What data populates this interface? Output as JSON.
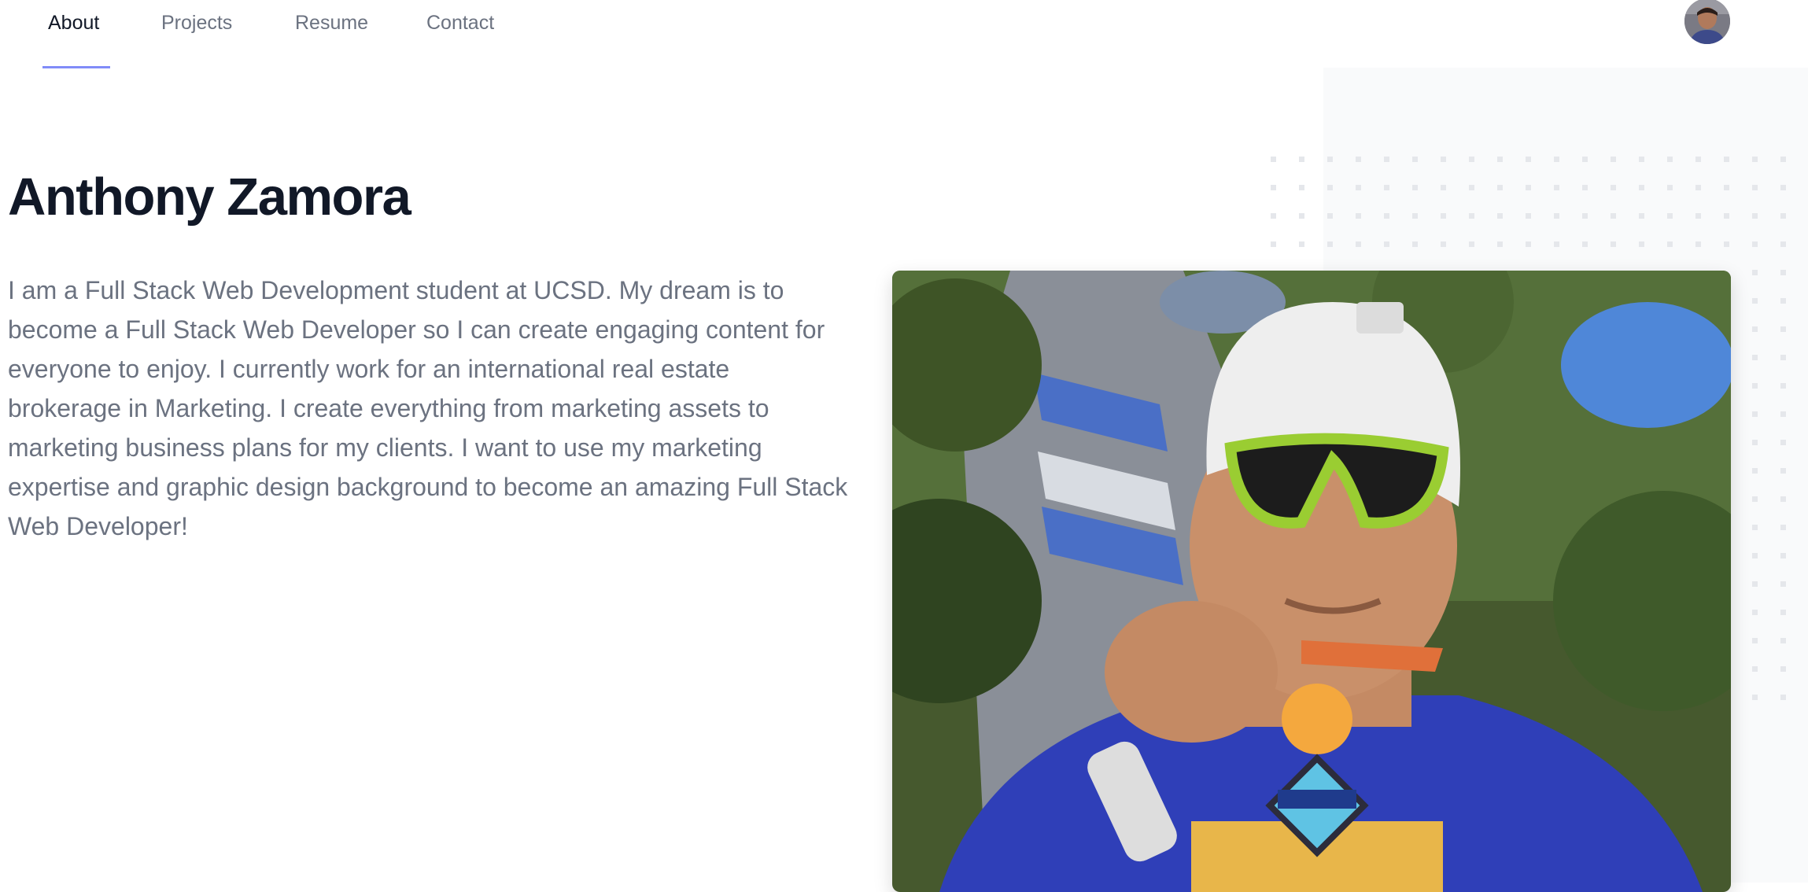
{
  "nav": {
    "tabs": [
      {
        "label": "About",
        "active": true
      },
      {
        "label": "Projects",
        "active": false
      },
      {
        "label": "Resume",
        "active": false
      },
      {
        "label": "Contact",
        "active": false
      }
    ],
    "active_underline_color": "#818cf8"
  },
  "profile": {
    "name": "Anthony Zamora",
    "bio": "I am a Full Stack Web Development student at UCSD. My dream is to become a Full Stack Web Developer so I can create engaging content for everyone to enjoy. I currently work for an international real estate brokerage in Marketing. I create everything from marketing assets to marketing business plans for my clients. I want to use my marketing expertise and graphic design background to become an amazing Full Stack Web Developer!"
  },
  "colors": {
    "heading": "#111827",
    "body_text": "#6b7280",
    "panel_bg": "#f9fafb",
    "dot_pattern": "#e5e7eb"
  },
  "icons": {
    "avatar": "user-avatar-photo"
  }
}
